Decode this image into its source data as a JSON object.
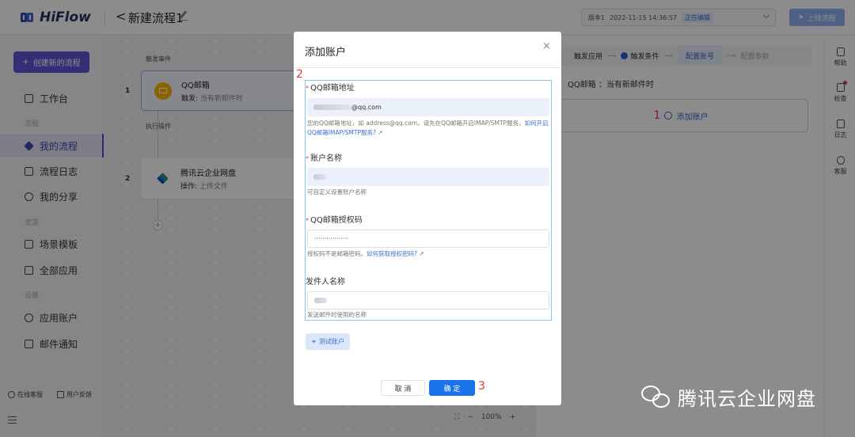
{
  "header": {
    "logo": "HiFlow",
    "back": "<",
    "flow_title": "新建流程1",
    "version_label": "版本1",
    "version_time": "2022-11-15 14:36:57",
    "version_status": "正在编辑",
    "publish_label": "上线流程"
  },
  "sidebar": {
    "create_label": "创建新的流程",
    "sections": [
      "流程",
      "资源",
      "设置"
    ],
    "items": [
      "工作台",
      "我的流程",
      "流程日志",
      "我的分享",
      "场景模板",
      "全部应用",
      "应用账户",
      "邮件通知"
    ],
    "footer": [
      "在线客服",
      "用户反馈"
    ]
  },
  "canvas": {
    "trigger_label": "触发事件",
    "action_label": "执行操作",
    "node1": {
      "num": "1",
      "title": "QQ邮箱",
      "sub_prefix": "触发:",
      "sub": "当有新邮件时"
    },
    "node2": {
      "num": "2",
      "title": "腾讯云企业网盘",
      "sub_prefix": "操作:",
      "sub": "上传文件"
    },
    "add": "+",
    "zoom": "100%"
  },
  "right_panel": {
    "steps": [
      "触发应用",
      "触发条件",
      "配置账号",
      "配置参数"
    ],
    "info": "QQ邮箱 ：当有新邮件时",
    "add_account": "添加账户",
    "marker": "1"
  },
  "right_tools": [
    "帮助",
    "检查",
    "日志",
    "客服"
  ],
  "modal": {
    "title": "添加账户",
    "close": "×",
    "marker_form": "2",
    "marker_confirm": "3",
    "fields": {
      "email_label": "QQ邮箱地址",
      "email_value": "@qq.com",
      "email_help": "您的QQ邮箱地址，如 address@qq.com。请先在QQ邮箱开启IMAP/SMTP服务，",
      "email_help_link": "如何开启QQ邮箱IMAP/SMTP服务?",
      "name_label": "账户名称",
      "name_help": "可自定义设置账户名称",
      "auth_label": "QQ邮箱授权码",
      "auth_value": "·················",
      "auth_help": "授权码不是邮箱密码。",
      "auth_help_link": "如何获取授权密码?",
      "sender_label": "发件人名称",
      "sender_help": "发送邮件时使用的名称"
    },
    "test_label": "测试账户",
    "cancel_label": "取 消",
    "ok_label": "确 定"
  },
  "watermark": "腾讯云企业网盘"
}
